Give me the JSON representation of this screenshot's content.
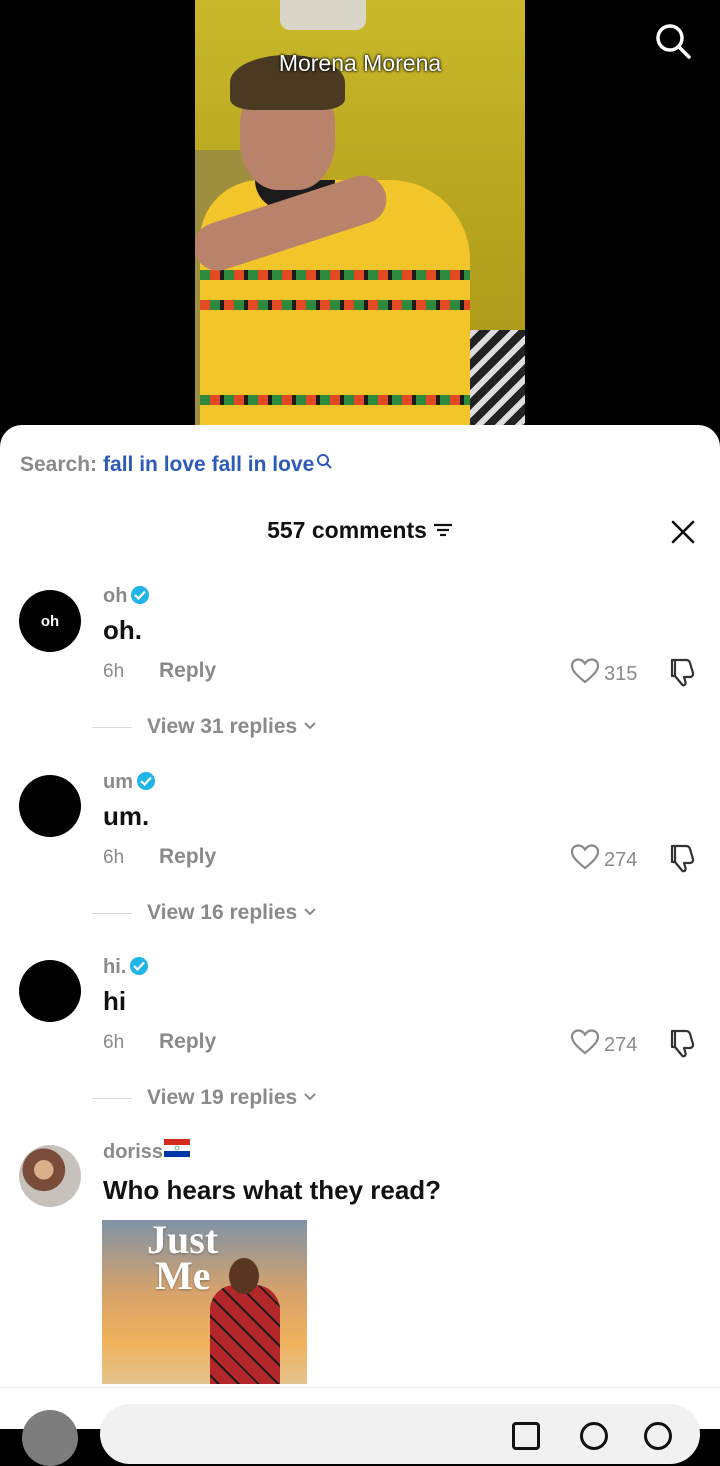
{
  "video": {
    "caption": "Morena Morena",
    "search_icon": "search-icon"
  },
  "search_bar": {
    "label": "Search:",
    "term": "fall in love fall in love",
    "icon": "search-icon"
  },
  "comments_header": {
    "title": "557 comments",
    "filter_icon": "filter-icon",
    "close_icon": "close-icon"
  },
  "comments": [
    {
      "avatar_text": "oh",
      "username": "oh",
      "verified": true,
      "text": "oh.",
      "time": "6h",
      "reply_label": "Reply",
      "likes": "315",
      "replies": "View 31 replies"
    },
    {
      "avatar_text": "",
      "username": "um",
      "verified": true,
      "text": "um.",
      "time": "6h",
      "reply_label": "Reply",
      "likes": "274",
      "replies": "View 16 replies"
    },
    {
      "avatar_text": "",
      "username": "hi.",
      "verified": true,
      "text": "hi",
      "time": "6h",
      "reply_label": "Reply",
      "likes": "274",
      "replies": "View 19 replies"
    },
    {
      "avatar_text": "",
      "username": "doriss",
      "flag": "paraguay-flag-icon",
      "text": "Who hears what they read?",
      "gif_title_line1": "Just",
      "gif_title_line2": "Me"
    }
  ],
  "colors": {
    "accent_blue": "#2d5bb8",
    "verified_blue": "#20b5e8",
    "muted_gray": "#8a8a8a",
    "text_dark": "#111111"
  }
}
